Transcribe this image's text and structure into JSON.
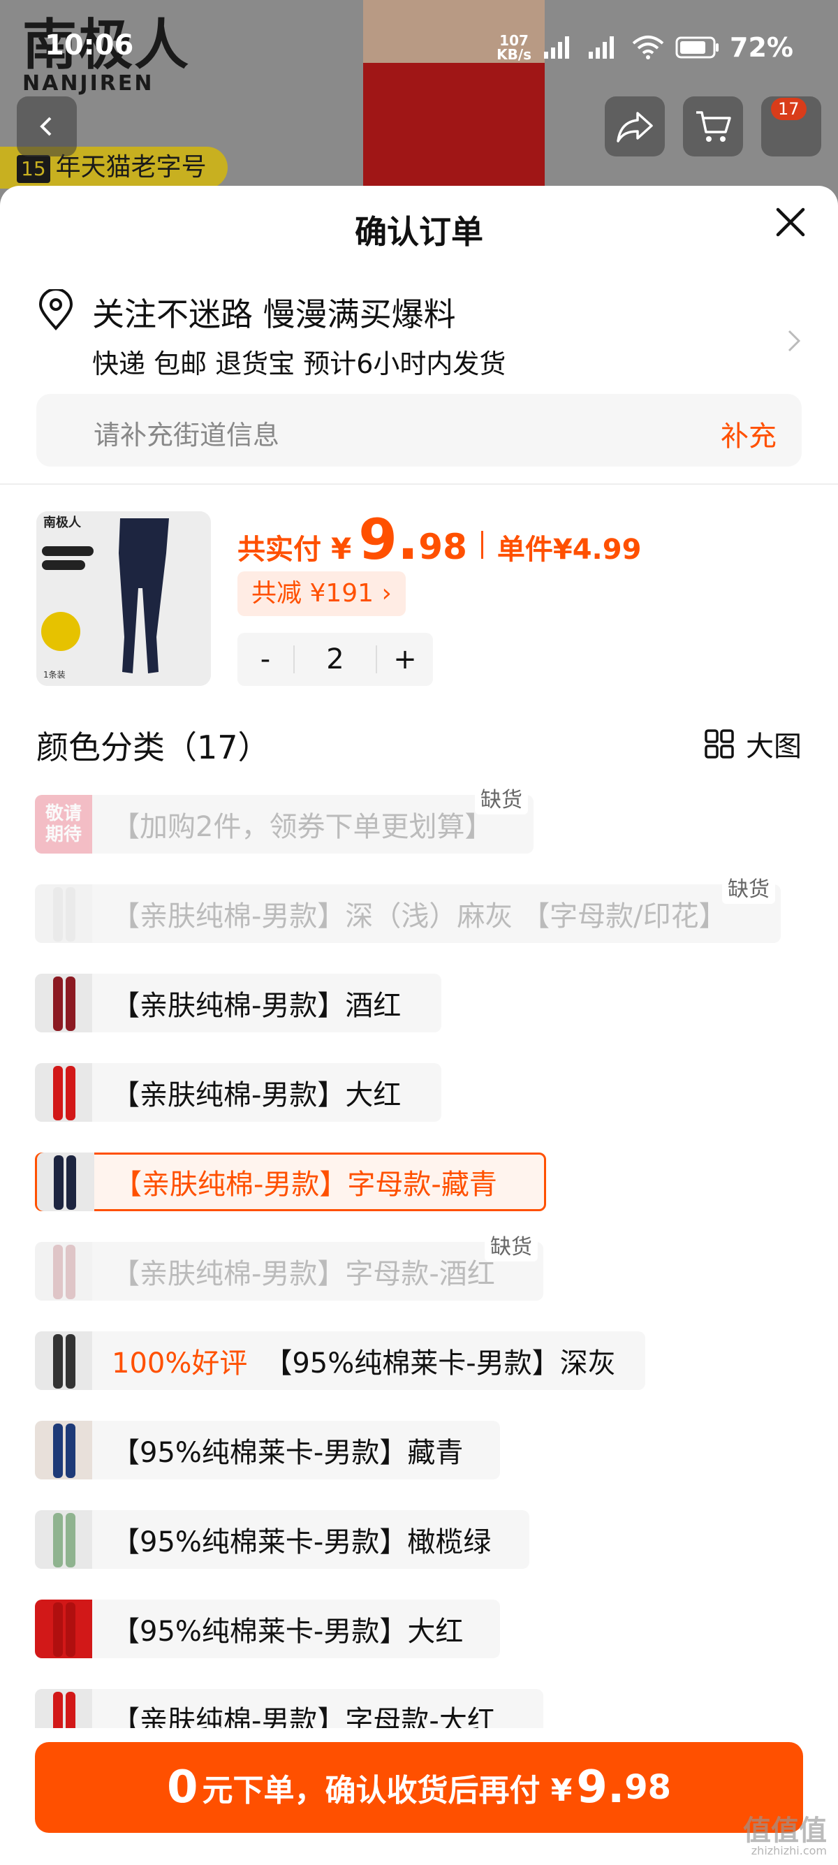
{
  "status_bar": {
    "time": "10:06",
    "net_speed_value": "107",
    "net_speed_unit": "KB/s",
    "battery": "72%"
  },
  "background": {
    "brand_cn": "南极人",
    "brand_en": "NANJIREN",
    "tmall_badge_num": "15",
    "tmall_badge_text": "年天猫老字号",
    "cart_count": "17"
  },
  "sheet": {
    "title": "确认订单"
  },
  "address": {
    "line1": "关注不迷路 慢漫满买爆料",
    "line2": "快递 包邮 退货宝 预计6小时内发货",
    "street_placeholder": "请补充街道信息",
    "street_button": "补充"
  },
  "product": {
    "total_label": "共实付",
    "currency": "¥",
    "price_int": "9.",
    "price_dec": "98",
    "unit_label": "单件",
    "unit_price": "¥4.99",
    "saving": "共减 ¥191 ›",
    "qty_minus": "-",
    "qty": "2",
    "qty_plus": "+"
  },
  "options": {
    "title": "颜色分类（17）",
    "big_image_label": "大图",
    "sold_out_label": "缺货",
    "good_review_label": "100%好评",
    "items": [
      {
        "label": "【加购2件，领券下单更划算】"
      },
      {
        "label": "【亲肤纯棉-男款】深（浅）麻灰 【字母款/印花】"
      },
      {
        "label": "【亲肤纯棉-男款】酒红"
      },
      {
        "label": "【亲肤纯棉-男款】大红"
      },
      {
        "label": "【亲肤纯棉-男款】字母款-藏青"
      },
      {
        "label": "【亲肤纯棉-男款】字母款-酒红"
      },
      {
        "label": "【95%纯棉莱卡-男款】深灰"
      },
      {
        "label": "【95%纯棉莱卡-男款】藏青"
      },
      {
        "label": "【95%纯棉莱卡-男款】橄榄绿"
      },
      {
        "label": "【95%纯棉莱卡-男款】大红"
      },
      {
        "label": "【亲肤纯棉-男款】字母款-大红"
      }
    ],
    "placeholder_thumb_text": "敬请期待"
  },
  "bottom_bar": {
    "zero": "0",
    "middle": "元下单，确认收货后再付 ¥",
    "price_int": "9.",
    "price_dec": "98"
  },
  "watermark": {
    "main": "值值值",
    "sub": "zhizhizhi.com"
  }
}
